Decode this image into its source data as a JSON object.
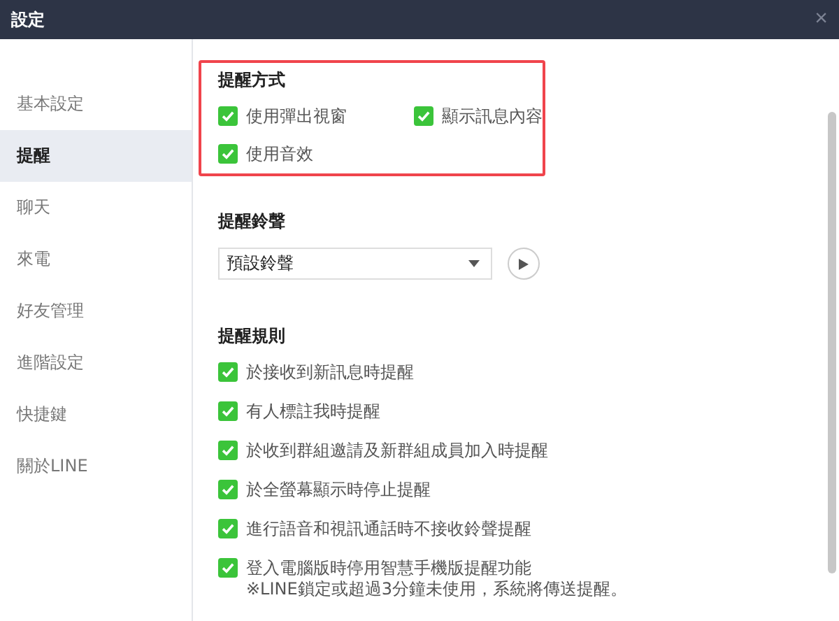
{
  "window": {
    "title": "設定",
    "close": "×"
  },
  "sidebar": {
    "items": [
      {
        "label": "基本設定",
        "selected": false
      },
      {
        "label": "提醒",
        "selected": true
      },
      {
        "label": "聊天",
        "selected": false
      },
      {
        "label": "來電",
        "selected": false
      },
      {
        "label": "好友管理",
        "selected": false
      },
      {
        "label": "進階設定",
        "selected": false
      },
      {
        "label": "快捷鍵",
        "selected": false
      },
      {
        "label": "關於LINE",
        "selected": false
      }
    ]
  },
  "sections": [
    {
      "kind": "checkgrid",
      "title": "提醒方式",
      "highlighted": true,
      "options": [
        {
          "label": "使用彈出視窗",
          "checked": true
        },
        {
          "label": "顯示訊息內容",
          "checked": true
        },
        {
          "label": "使用音效",
          "checked": true
        }
      ]
    },
    {
      "kind": "sound",
      "title": "提醒鈴聲",
      "value": "預設鈴聲"
    },
    {
      "kind": "checklist",
      "title": "提醒規則",
      "options": [
        {
          "label": "於接收到新訊息時提醒",
          "checked": true
        },
        {
          "label": "有人標註我時提醒",
          "checked": true
        },
        {
          "label": "於收到群組邀請及新群組成員加入時提醒",
          "checked": true
        },
        {
          "label": "於全螢幕顯示時停止提醒",
          "checked": true
        },
        {
          "label": "進行語音和視訊通話時不接收鈴聲提醒",
          "checked": true
        },
        {
          "label": "登入電腦版時停用智慧手機版提醒功能",
          "note": "※LINE鎖定或超過3分鐘未使用，系統將傳送提醒。",
          "checked": true
        }
      ]
    }
  ]
}
